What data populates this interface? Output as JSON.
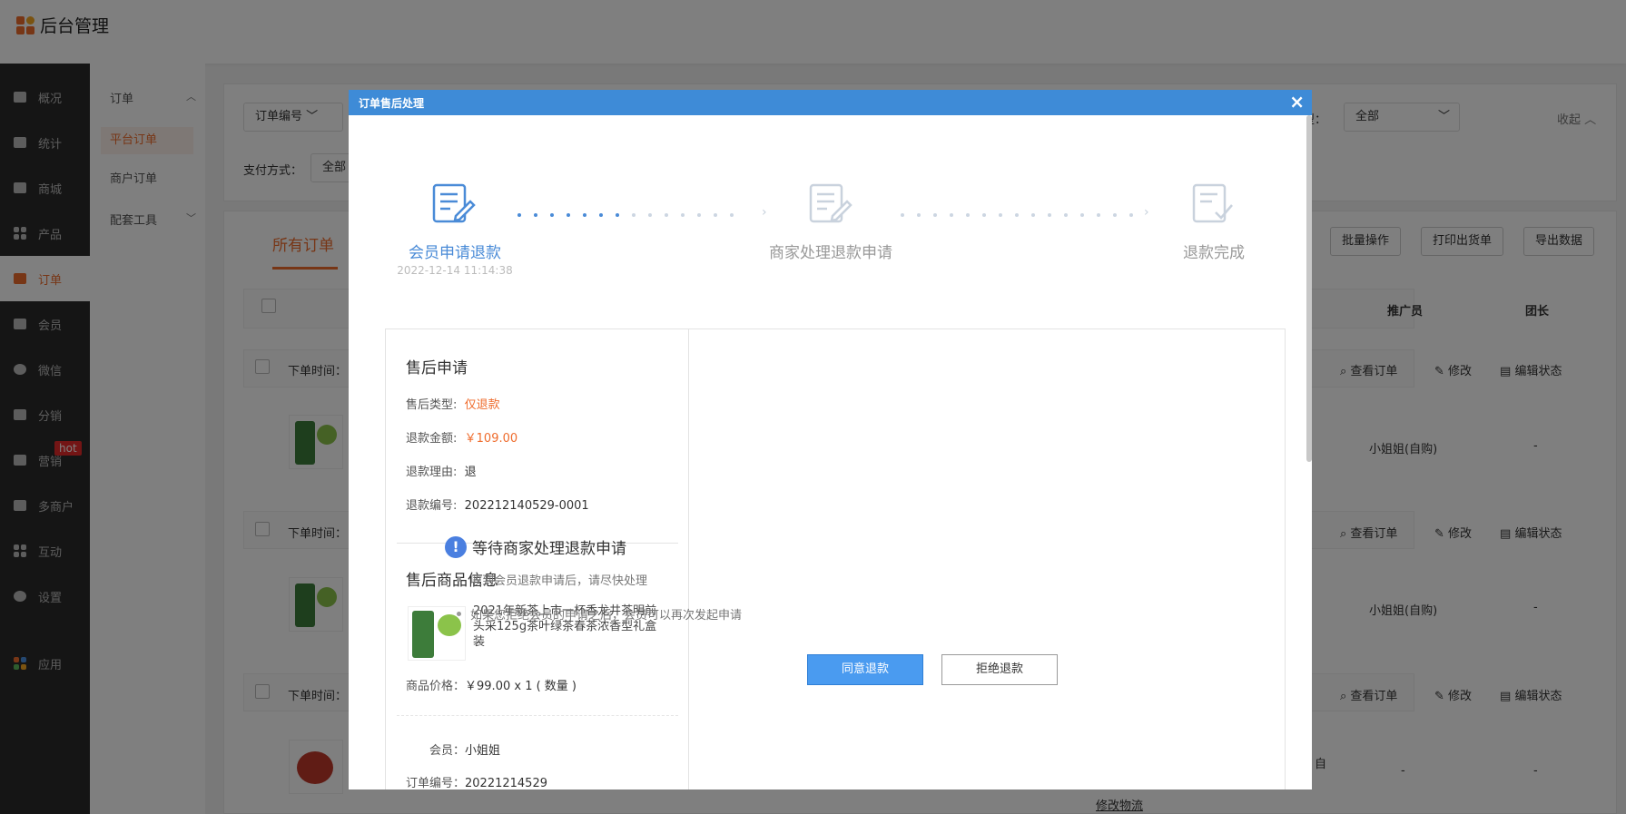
{
  "app": {
    "title": "后台管理"
  },
  "leftnav": {
    "items": [
      {
        "label": "概况",
        "icon": "layers-icon"
      },
      {
        "label": "统计",
        "icon": "chart-icon"
      },
      {
        "label": "商城",
        "icon": "mail-icon"
      },
      {
        "label": "产品",
        "icon": "grid-icon"
      },
      {
        "label": "订单",
        "icon": "clipboard-icon"
      },
      {
        "label": "会员",
        "icon": "crown-icon"
      },
      {
        "label": "微信",
        "icon": "wechat-icon"
      },
      {
        "label": "分销",
        "icon": "users-icon"
      },
      {
        "label": "营销",
        "icon": "flag-icon"
      },
      {
        "label": "多商户",
        "icon": "store-icon"
      },
      {
        "label": "互动",
        "icon": "interact-icon"
      },
      {
        "label": "设置",
        "icon": "gear-icon"
      },
      {
        "label": "应用",
        "icon": "apps-icon"
      }
    ],
    "hot_badge": "hot",
    "active": "订单"
  },
  "subnav": {
    "group1": "订单",
    "items": [
      "平台订单",
      "商户订单"
    ],
    "group2": "配套工具"
  },
  "filters": {
    "order_no_select": "订单编号",
    "type_label": "型：",
    "type_value": "全部",
    "collapse": "收起",
    "pay_label": "支付方式：",
    "pay_value": "全部"
  },
  "toolbar": {
    "tab_all": "所有订单",
    "batch": "批量操作",
    "print": "打印出货单",
    "export": "导出数据"
  },
  "table": {
    "col_promoter": "推广员",
    "col_leader": "团长",
    "row_time_label": "下单时间：",
    "view_order": "查看订单",
    "modify": "修改",
    "edit_status": "编辑状态",
    "promoter_value": "小姐姐(自购)",
    "dash": "-",
    "modify_logistics": "修改物流",
    "partial": "自"
  },
  "modal": {
    "title": "订单售后处理",
    "close": "×",
    "steps": [
      {
        "label": "会员申请退款",
        "time": "2022-12-14 11:14:38"
      },
      {
        "label": "商家处理退款申请"
      },
      {
        "label": "退款完成"
      }
    ],
    "aftersale": {
      "title": "售后申请",
      "type_label": "售后类型:",
      "type_value": "仅退款",
      "amount_label": "退款金额:",
      "amount_value": "￥109.00",
      "reason_label": "退款理由:",
      "reason_value": "退",
      "no_label": "退款编号:",
      "no_value": "202212140529-0001"
    },
    "product": {
      "title": "售后商品信息",
      "name": "2021年新茶上市一杯香龙井茶明前头采125g茶叶绿茶春茶浓香型礼盒装",
      "price_label": "商品价格：",
      "price_value": "￥99.00 x 1 ( 数量 )"
    },
    "member": {
      "label": "会员：",
      "value": "小姐姐",
      "order_label": "订单编号：",
      "order_value": "20221214529"
    },
    "status": {
      "title": "等待商家处理退款申请",
      "tips": [
        "收到会员退款申请后，请尽快处理",
        "如果您拒绝会员的申请之后，会员可以再次发起申请"
      ],
      "agree": "同意退款",
      "refuse": "拒绝退款"
    }
  }
}
